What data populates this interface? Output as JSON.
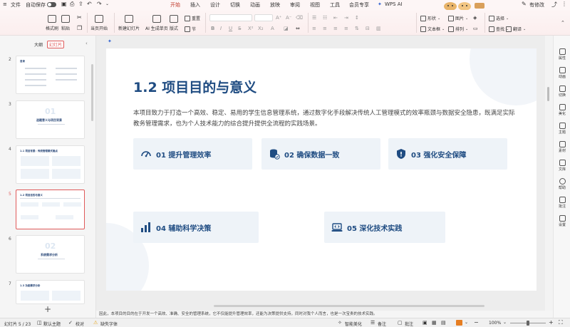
{
  "menubar": {
    "file": "文件",
    "autosave": "自动保存",
    "tabs": [
      "开始",
      "插入",
      "设计",
      "切换",
      "动画",
      "放映",
      "审阅",
      "视图",
      "工具",
      "会员专享"
    ],
    "wps_ai": "WPS AI",
    "edit_status": "有修改"
  },
  "ribbon": {
    "format_brush": "格式刷",
    "paste": "粘贴",
    "play_from_current": "当页开始",
    "new_slide": "新建幻灯片",
    "ai_generate": "AI 生成单页",
    "layout": "版式",
    "section": "节",
    "reset": "重置",
    "shape": "形状",
    "picture": "图片",
    "select": "选择",
    "textbox": "文本框",
    "arrange": "排列",
    "find": "查找",
    "translate": "翻译"
  },
  "leftpanel": {
    "tab_outline": "大纲",
    "tab_slides": "幻灯片",
    "thumbs": [
      {
        "num": "2",
        "title": "目录"
      },
      {
        "num": "3",
        "title": "选题意义与项目背景",
        "big": "01"
      },
      {
        "num": "4",
        "title": "1.1 项目背景：传统管理模式痛点"
      },
      {
        "num": "5",
        "title": "1.2 项目目的与意义"
      },
      {
        "num": "6",
        "title": "系统需求分析",
        "big": "02"
      },
      {
        "num": "7",
        "title": "1.3 功能需求分析"
      }
    ],
    "add": "+"
  },
  "slide": {
    "title": "1.2 项目目的与意义",
    "body": "本项目致力于打造一个高效、稳定、易用的学生信息管理系统，通过数字化手段解决传统人工管理模式的效率瓶颈与数据安全隐患，既满足实际教务管理需求，也为个人技术能力的综合提升提供全流程的实践场景。",
    "cards": [
      {
        "label": "01 提升管理效率",
        "icon": "speedometer-icon"
      },
      {
        "label": "02 确保数据一致",
        "icon": "database-check-icon"
      },
      {
        "label": "03 强化安全保障",
        "icon": "shield-icon"
      },
      {
        "label": "04 辅助科学决策",
        "icon": "bar-chart-icon"
      },
      {
        "label": "05 深化技术实践",
        "icon": "laptop-code-icon"
      }
    ]
  },
  "rightbar": [
    "属性",
    "动画",
    "切换",
    "美化",
    "主题",
    "素材",
    "文库",
    "帮助",
    "批注",
    "设置"
  ],
  "notes": "因此，本项目的目的在于开发一个高效、准确、安全的管理系统，它不仅能提升管理效率，还能为决策提供支持，同时对我个人而言，也是一次宝贵的技术实践。",
  "status": {
    "slide_count": "幻灯片 5 / 23",
    "theme": "默认主题",
    "proof": "校对",
    "missing_font": "缺失字体",
    "smart_beautify": "智能美化",
    "notes_btn": "备注",
    "comments_btn": "批注",
    "zoom": "100%"
  }
}
